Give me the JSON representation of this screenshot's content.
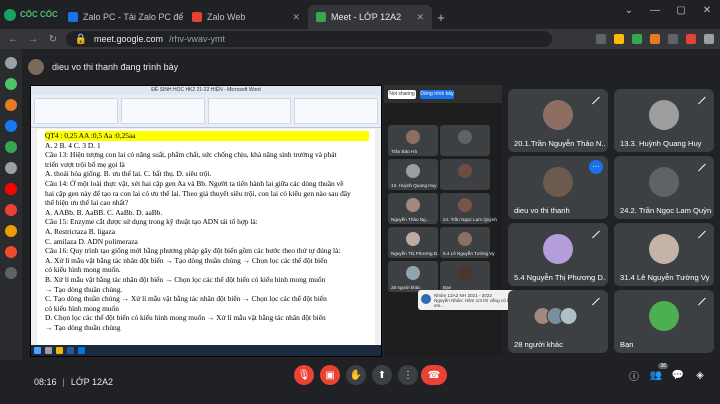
{
  "browser": {
    "brand": "CỐC CỐC",
    "tabs": [
      {
        "label": "Zalo PC - Tải Zalo PC để làm",
        "fav": "#1a73e8",
        "active": false
      },
      {
        "label": "Zalo Web",
        "fav": "#e84235",
        "active": false
      },
      {
        "label": "Meet - LỚP 12A2",
        "fav": "#34a853",
        "active": true
      }
    ],
    "url_host": "meet.google.com",
    "url_path": "/rhv-vwav-ymt"
  },
  "presenter": {
    "text": "dieu vo thi thanh đang trình bày"
  },
  "word": {
    "title": "ĐỀ SINH HỌC HK2 21-22 HIỆN - Microsoft Word",
    "lines": [
      {
        "text": "QT4 : 0,25 AA :0,5 Aa :0,25aa",
        "style": "hl-y"
      },
      {
        "text": "A. 2              B. 4              C. 3              D. 1",
        "style": ""
      },
      {
        "text": "Câu 13: Hiện tượng con lai có năng suất, phẩm chất, sức chống chịu, khả năng sinh trưởng và phát",
        "style": ""
      },
      {
        "text": "triển vượt trội bố mẹ gọi là",
        "style": ""
      },
      {
        "text": "A. thoái hóa giống.       B. ưu thế lai.         C. bất thụ.          D. siêu trội.",
        "style": ""
      },
      {
        "text": "Câu 14: Ở một loài thực vật, xét hai cặp gen Aa và Bb. Người ta tiến hành lai giữa các dòng thuần về",
        "style": ""
      },
      {
        "text": "hai cặp gen này để tạo ra con lai có ưu thế lai. Theo giả thuyết siêu trội, con lai có kiểu gen nào sau đây",
        "style": ""
      },
      {
        "text": "thể hiện ưu thế lai cao nhất?",
        "style": ""
      },
      {
        "text": "A. AABb.          B. AaBB.          C. AaBb.          D. aaBb.",
        "style": ""
      },
      {
        "text": "Câu 15: Enzyme cắt được sử dụng trong kỹ thuật tạo ADN tái tổ hợp là:",
        "style": ""
      },
      {
        "text": "A. Restrictaza                        B. ligaza",
        "style": ""
      },
      {
        "text": "C. amilaza                           D. ADN polimeraza",
        "style": ""
      },
      {
        "text": "Câu 16: Quy trình tạo giống mới bằng phương pháp gây đột biến gồm các bước theo thứ tự đúng là:",
        "style": ""
      },
      {
        "text": "   A. Xử lí mẫu vật bằng tác nhân đột biến → Tạo dòng thuần chủng → Chọn lọc các thể đột biến",
        "style": ""
      },
      {
        "text": "có kiểu hình mong muốn.",
        "style": ""
      },
      {
        "text": "   B. Xử lí mẫu vật bằng tác nhân đột biến → Chọn lọc các thể đột biến có kiểu hình mong muốn",
        "style": ""
      },
      {
        "text": "→ Tạo dòng thuần chủng.",
        "style": ""
      },
      {
        "text": "   C. Tạo dòng thuần chủng → Xử lí mẫu vật bằng tác nhân đột biến → Chọn lọc các thể đột biến",
        "style": ""
      },
      {
        "text": "có kiểu hình mong muốn",
        "style": ""
      },
      {
        "text": "   D. Chọn lọc các thể đột biến có kiểu hình mong muốn → Xử lí mẫu vật bằng tác nhân đột biến",
        "style": ""
      },
      {
        "text": "→ Tạo dòng thuần chủng",
        "style": ""
      }
    ]
  },
  "second_panel": {
    "btn_sharing": "Not sharing",
    "label": "Dừng trình bày",
    "minis": [
      {
        "name": "Trần Bảo Hà",
        "face": "#8d6e63"
      },
      {
        "name": "",
        "face": "#5f6368"
      },
      {
        "name": "13. Huỳnh Quang Huy",
        "face": "#9e9e9e"
      },
      {
        "name": "",
        "face": "#6d4c41"
      },
      {
        "name": "Nguyễn Thảo Ng...",
        "face": "#a1887f"
      },
      {
        "name": "24. Trần Ngọc Lam Quỳnh",
        "face": "#795548"
      },
      {
        "name": "Nguyễn Thị Phương D...",
        "face": "#bcaaa4"
      },
      {
        "name": "5.4 Lê Nguyễn Tường Vy",
        "face": "#8d6e63"
      },
      {
        "name": "28 người khác",
        "face": "#90a4ae"
      },
      {
        "name": "Bạn",
        "face": "#4e342e"
      }
    ],
    "notif_title": "Nhóm 12A2 NH 2021 - 2022",
    "notif_body": "Nguyễn Nhân: Hôm 1/4 thì vắng có bảo em..."
  },
  "participants": [
    {
      "name": "20.1.Trần Nguyễn Thảo N...",
      "color": "#8d6e63",
      "kind": "photo"
    },
    {
      "name": "13.3. Huỳnh Quang Huy",
      "color": "#9e9e9e",
      "kind": "photo"
    },
    {
      "name": "dieu vo thi thanh",
      "color": "#6d5a4f",
      "kind": "photo"
    },
    {
      "name": "24.2. Trần Ngọc Lam Quỳn...",
      "color": "#5f6368",
      "kind": "default"
    },
    {
      "name": "5.4 Nguyễn Thị Phương D...",
      "color": "#b39ddb",
      "kind": "photo"
    },
    {
      "name": "31.4 Lê Nguyễn Tường Vy",
      "color": "#c5b3a7",
      "kind": "photo"
    },
    {
      "name": "28 người khác",
      "color": "#78909c",
      "kind": "stack"
    },
    {
      "name": "Bạn",
      "color": "#4caf50",
      "kind": "photo"
    }
  ],
  "meeting": {
    "time": "08:16",
    "separator": "|",
    "name": "LỚP 12A2",
    "people_count": "36"
  }
}
